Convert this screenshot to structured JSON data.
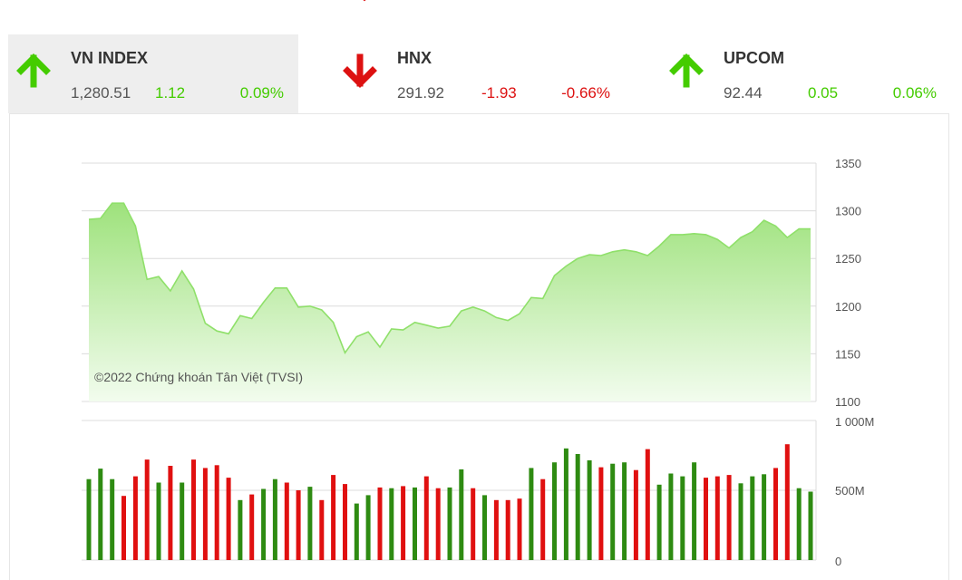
{
  "colors": {
    "up": "#44cc00",
    "down": "#dd1111",
    "bar_up": "#2e8b12",
    "bar_down": "#e01010",
    "area_line": "#8fe06a"
  },
  "tickers": [
    {
      "name": "VN INDEX",
      "value": "1,280.51",
      "change": "1.12",
      "pct": "0.09%",
      "direction": "up",
      "icon": "arrow-up-icon"
    },
    {
      "name": "HNX",
      "value": "291.92",
      "change": "-1.93",
      "pct": "-0.66%",
      "direction": "down",
      "icon": "arrow-down-icon"
    },
    {
      "name": "UPCOM",
      "value": "92.44",
      "change": "0.05",
      "pct": "0.06%",
      "direction": "up",
      "icon": "arrow-up-icon"
    }
  ],
  "chart_data": [
    {
      "type": "area",
      "copyright": "©2022 Chứng khoán Tân Việt (TVSI)",
      "ylim": [
        1100,
        1350
      ],
      "y_ticks": [
        "1350",
        "1300",
        "1250",
        "1200",
        "1150",
        "1100"
      ],
      "grid": true,
      "values": [
        1291,
        1292,
        1308,
        1308,
        1284,
        1228,
        1231,
        1216,
        1237,
        1218,
        1182,
        1174,
        1171,
        1190,
        1187,
        1204,
        1219,
        1219,
        1199,
        1200,
        1196,
        1183,
        1151,
        1168,
        1173,
        1157,
        1176,
        1175,
        1183,
        1180,
        1177,
        1179,
        1195,
        1199,
        1195,
        1188,
        1185,
        1192,
        1209,
        1208,
        1232,
        1242,
        1250,
        1254,
        1253,
        1257,
        1259,
        1257,
        1253,
        1263,
        1275,
        1275,
        1276,
        1275,
        1270,
        1261,
        1272,
        1278,
        1290,
        1284,
        1272,
        1281,
        1281
      ]
    },
    {
      "type": "bar",
      "ylim": [
        0,
        1000
      ],
      "y_ticks": [
        "1 000M",
        "500M",
        "0"
      ],
      "values": [
        580,
        655,
        580,
        460,
        600,
        720,
        555,
        675,
        555,
        720,
        660,
        680,
        590,
        430,
        470,
        510,
        580,
        555,
        500,
        525,
        430,
        610,
        545,
        405,
        465,
        520,
        515,
        530,
        520,
        600,
        515,
        520,
        650,
        515,
        465,
        430,
        430,
        440,
        660,
        580,
        700,
        800,
        760,
        715,
        665,
        690,
        700,
        645,
        795,
        540,
        620,
        600,
        700,
        590,
        600,
        610,
        550,
        600,
        615,
        660,
        830,
        515,
        490
      ],
      "directions": [
        "up",
        "up",
        "up",
        "down",
        "down",
        "down",
        "up",
        "down",
        "up",
        "down",
        "down",
        "down",
        "down",
        "up",
        "down",
        "up",
        "up",
        "down",
        "down",
        "up",
        "down",
        "down",
        "down",
        "up",
        "up",
        "down",
        "up",
        "down",
        "up",
        "down",
        "down",
        "up",
        "up",
        "down",
        "up",
        "down",
        "down",
        "down",
        "up",
        "down",
        "up",
        "up",
        "up",
        "up",
        "down",
        "up",
        "up",
        "down",
        "down",
        "up",
        "up",
        "up",
        "up",
        "down",
        "down",
        "down",
        "up",
        "up",
        "up",
        "down",
        "down",
        "up",
        "up"
      ]
    }
  ]
}
